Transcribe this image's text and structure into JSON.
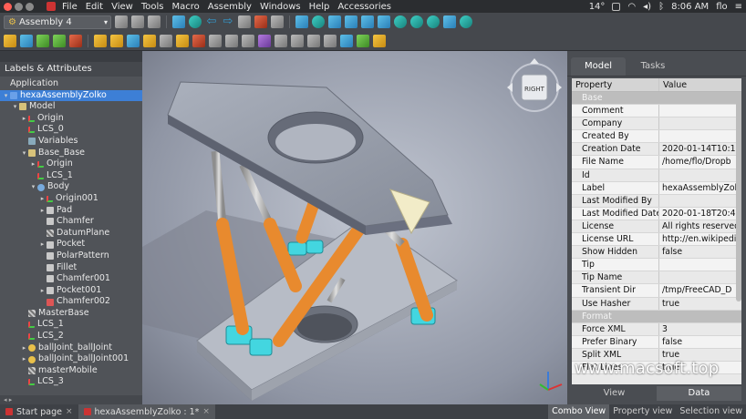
{
  "menubar": {
    "items": [
      "File",
      "Edit",
      "View",
      "Tools",
      "Macro",
      "Assembly",
      "Windows",
      "Help",
      "Accessories"
    ],
    "temperature": "14°",
    "time": "8:06 AM",
    "user": "flo"
  },
  "workbench": {
    "selected": "Assembly 4"
  },
  "left_panel": {
    "title": "Labels & Attributes",
    "tree": [
      {
        "label": "Application",
        "depth": 0,
        "icon": "none",
        "arrow": ""
      },
      {
        "label": "hexaAssemblyZolko",
        "depth": 0,
        "icon": "asm",
        "arrow": "▾",
        "selected": true
      },
      {
        "label": "Model",
        "depth": 1,
        "icon": "fold",
        "arrow": "▾"
      },
      {
        "label": "Origin",
        "depth": 2,
        "icon": "axis",
        "arrow": "▸"
      },
      {
        "label": "LCS_0",
        "depth": 2,
        "icon": "axis",
        "arrow": ""
      },
      {
        "label": "Variables",
        "depth": 2,
        "icon": "var",
        "arrow": ""
      },
      {
        "label": "Base_Base",
        "depth": 2,
        "icon": "fold",
        "arrow": "▾"
      },
      {
        "label": "Origin",
        "depth": 3,
        "icon": "axis",
        "arrow": "▸"
      },
      {
        "label": "LCS_1",
        "depth": 3,
        "icon": "axis",
        "arrow": ""
      },
      {
        "label": "Body",
        "depth": 3,
        "icon": "body",
        "arrow": "▾"
      },
      {
        "label": "Origin001",
        "depth": 4,
        "icon": "axis",
        "arrow": "▸"
      },
      {
        "label": "Pad",
        "depth": 4,
        "icon": "feat",
        "arrow": "▸"
      },
      {
        "label": "Chamfer",
        "depth": 4,
        "icon": "feat",
        "arrow": ""
      },
      {
        "label": "DatumPlane",
        "depth": 4,
        "icon": "hatch",
        "arrow": ""
      },
      {
        "label": "Pocket",
        "depth": 4,
        "icon": "feat",
        "arrow": "▸"
      },
      {
        "label": "PolarPattern",
        "depth": 4,
        "icon": "feat",
        "arrow": ""
      },
      {
        "label": "Fillet",
        "depth": 4,
        "icon": "feat",
        "arrow": ""
      },
      {
        "label": "Chamfer001",
        "depth": 4,
        "icon": "feat",
        "arrow": ""
      },
      {
        "label": "Pocket001",
        "depth": 4,
        "icon": "feat",
        "arrow": "▸"
      },
      {
        "label": "Chamfer002",
        "depth": 4,
        "icon": "red",
        "arrow": ""
      },
      {
        "label": "MasterBase",
        "depth": 2,
        "icon": "hatch",
        "arrow": ""
      },
      {
        "label": "LCS_1",
        "depth": 2,
        "icon": "axis",
        "arrow": ""
      },
      {
        "label": "LCS_2",
        "depth": 2,
        "icon": "axis",
        "arrow": ""
      },
      {
        "label": "ballJoint_ballJoint",
        "depth": 2,
        "icon": "link",
        "arrow": "▸"
      },
      {
        "label": "ballJoint_ballJoint001",
        "depth": 2,
        "icon": "link",
        "arrow": "▸"
      },
      {
        "label": "masterMobile",
        "depth": 2,
        "icon": "hatch",
        "arrow": ""
      },
      {
        "label": "LCS_3",
        "depth": 2,
        "icon": "axis",
        "arrow": ""
      }
    ]
  },
  "viewport": {
    "navcube_label": "RIGHT"
  },
  "right_panel": {
    "tabs": [
      "Model",
      "Tasks"
    ],
    "active_tab": "Model",
    "columns": [
      "Property",
      "Value"
    ],
    "rows": [
      {
        "group": true,
        "name": "Base",
        "value": ""
      },
      {
        "name": "Comment",
        "value": ""
      },
      {
        "name": "Company",
        "value": ""
      },
      {
        "name": "Created By",
        "value": ""
      },
      {
        "name": "Creation Date",
        "value": "2020-01-14T10:10"
      },
      {
        "name": "File Name",
        "value": "/home/flo/Dropb"
      },
      {
        "name": "Id",
        "value": ""
      },
      {
        "name": "Label",
        "value": "hexaAssemblyZol"
      },
      {
        "name": "Last Modified By",
        "value": ""
      },
      {
        "name": "Last Modified Date",
        "value": "2020-01-18T20:4"
      },
      {
        "name": "License",
        "value": "All rights reserved"
      },
      {
        "name": "License URL",
        "value": "http://en.wikipedi"
      },
      {
        "name": "Show Hidden",
        "value": "false"
      },
      {
        "name": "Tip",
        "value": ""
      },
      {
        "name": "Tip Name",
        "value": ""
      },
      {
        "name": "Transient Dir",
        "value": "/tmp/FreeCAD_D"
      },
      {
        "name": "Use Hasher",
        "value": "true"
      },
      {
        "group": true,
        "name": "Format",
        "value": ""
      },
      {
        "name": "Force XML",
        "value": "3"
      },
      {
        "name": "Prefer Binary",
        "value": "false"
      },
      {
        "name": "Split XML",
        "value": "true"
      },
      {
        "name": "Flat Lines",
        "value": "true"
      }
    ],
    "view_data": [
      "View",
      "Data"
    ],
    "active_view_data": "Data"
  },
  "bottom": {
    "tabs": [
      {
        "label": "Start page",
        "close": "×"
      },
      {
        "label": "hexaAssemblyZolko : 1*",
        "close": "×",
        "active": true
      }
    ],
    "right_tabs": [
      "Combo View",
      "Property view",
      "Selection view"
    ],
    "active_right_tab": "Combo View"
  },
  "watermark": "www.macsoft.top",
  "colors": {
    "accent": "#3d7fd6",
    "leg_orange": "#e88a2e",
    "joint_cyan": "#43d6e0",
    "plate_gray": "#9aa0ab"
  }
}
